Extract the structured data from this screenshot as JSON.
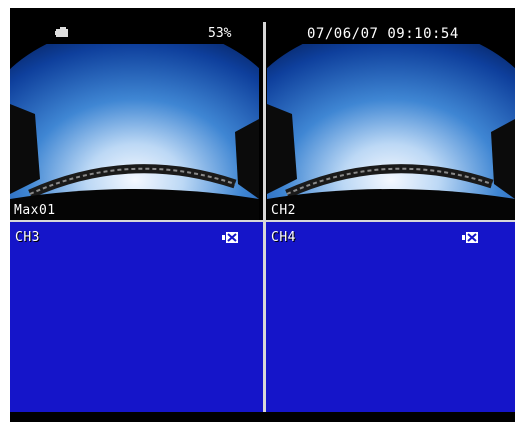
{
  "status": {
    "battery_percent": "53%",
    "datetime": "07/06/07 09:10:54",
    "icons": [
      "hdd-icon",
      "camera-icon"
    ]
  },
  "channels": [
    {
      "label": "Max01",
      "state": "live",
      "icon": "none"
    },
    {
      "label": "CH2",
      "state": "live",
      "icon": "none"
    },
    {
      "label": "CH3",
      "state": "video-loss",
      "icon": "video-loss-icon"
    },
    {
      "label": "CH4",
      "state": "video-loss",
      "icon": "video-loss-icon"
    }
  ],
  "colors": {
    "video_loss_background": "#1515c9",
    "divider": "#d8d8d8",
    "frame": "#000000"
  }
}
